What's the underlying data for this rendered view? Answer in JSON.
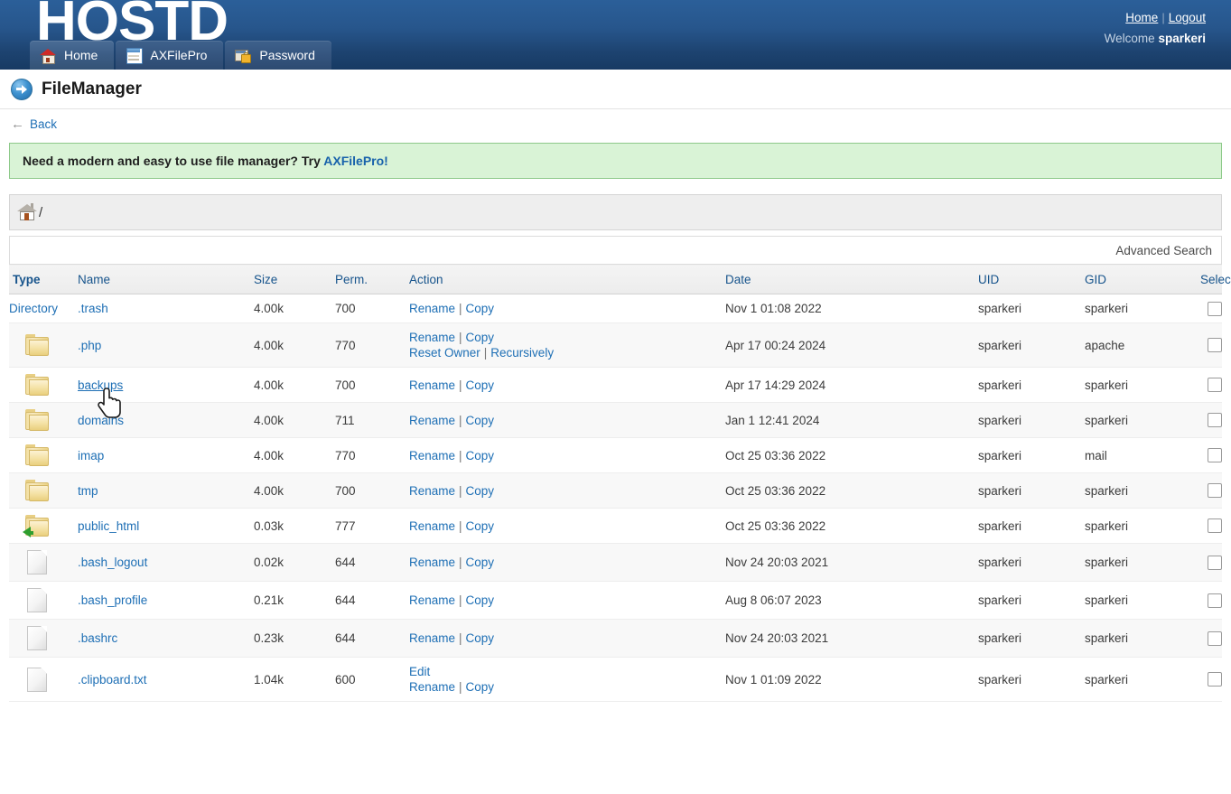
{
  "header": {
    "brand": "HOSTD",
    "links": {
      "home": "Home",
      "separator": "|",
      "logout": "Logout"
    },
    "welcome_prefix": "Welcome",
    "welcome_user": "sparkeri",
    "tabs": [
      {
        "label": "Home",
        "icon": "home-icon",
        "active": true
      },
      {
        "label": "AXFilePro",
        "icon": "axfilepro-icon",
        "active": false
      },
      {
        "label": "Password",
        "icon": "password-icon",
        "active": false
      }
    ]
  },
  "page": {
    "title": "FileManager",
    "title_icon": "arrow-right-circle-icon",
    "back_label": "Back",
    "back_icon": "arrow-left-icon"
  },
  "notice": {
    "text": "Need a modern and easy to use file manager? Try ",
    "link": "AXFilePro!"
  },
  "breadcrumb": {
    "home_icon": "home-icon",
    "path": "/"
  },
  "search": {
    "advanced_label": "Advanced Search"
  },
  "table": {
    "columns": [
      "Type",
      "Name",
      "Size",
      "Perm.",
      "Action",
      "Date",
      "UID",
      "GID",
      "Select"
    ],
    "actions": {
      "rename": "Rename",
      "copy": "Copy",
      "reset_owner": "Reset Owner",
      "recursively": "Recursively",
      "edit": "Edit",
      "pipe": "|"
    },
    "rows": [
      {
        "type": "Directory",
        "type_kind": "text",
        "name": ".trash",
        "size": "4.00k",
        "perm": "700",
        "actions": [
          "Rename | Copy"
        ],
        "date": "Nov 1 01:08 2022",
        "uid": "sparkeri",
        "gid": "sparkeri",
        "hovered": false
      },
      {
        "type": "",
        "type_kind": "folder",
        "name": ".php",
        "size": "4.00k",
        "perm": "770",
        "actions": [
          "Rename | Copy",
          "Reset Owner | Recursively"
        ],
        "date": "Apr 17 00:24 2024",
        "uid": "sparkeri",
        "gid": "apache",
        "hovered": false
      },
      {
        "type": "",
        "type_kind": "folder",
        "name": "backups",
        "size": "4.00k",
        "perm": "700",
        "actions": [
          "Rename | Copy"
        ],
        "date": "Apr 17 14:29 2024",
        "uid": "sparkeri",
        "gid": "sparkeri",
        "hovered": true
      },
      {
        "type": "",
        "type_kind": "folder",
        "name": "domains",
        "size": "4.00k",
        "perm": "711",
        "actions": [
          "Rename | Copy"
        ],
        "date": "Jan 1 12:41 2024",
        "uid": "sparkeri",
        "gid": "sparkeri",
        "hovered": false
      },
      {
        "type": "",
        "type_kind": "folder",
        "name": "imap",
        "size": "4.00k",
        "perm": "770",
        "actions": [
          "Rename | Copy"
        ],
        "date": "Oct 25 03:36 2022",
        "uid": "sparkeri",
        "gid": "mail",
        "hovered": false
      },
      {
        "type": "",
        "type_kind": "folder",
        "name": "tmp",
        "size": "4.00k",
        "perm": "700",
        "actions": [
          "Rename | Copy"
        ],
        "date": "Oct 25 03:36 2022",
        "uid": "sparkeri",
        "gid": "sparkeri",
        "hovered": false
      },
      {
        "type": "",
        "type_kind": "folder-link",
        "name": "public_html",
        "size": "0.03k",
        "perm": "777",
        "actions": [
          "Rename | Copy"
        ],
        "date": "Oct 25 03:36 2022",
        "uid": "sparkeri",
        "gid": "sparkeri",
        "hovered": false
      },
      {
        "type": "",
        "type_kind": "file",
        "name": ".bash_logout",
        "size": "0.02k",
        "perm": "644",
        "actions": [
          "Rename | Copy"
        ],
        "date": "Nov 24 20:03 2021",
        "uid": "sparkeri",
        "gid": "sparkeri",
        "hovered": false
      },
      {
        "type": "",
        "type_kind": "file",
        "name": ".bash_profile",
        "size": "0.21k",
        "perm": "644",
        "actions": [
          "Rename | Copy"
        ],
        "date": "Aug 8 06:07 2023",
        "uid": "sparkeri",
        "gid": "sparkeri",
        "hovered": false
      },
      {
        "type": "",
        "type_kind": "file",
        "name": ".bashrc",
        "size": "0.23k",
        "perm": "644",
        "actions": [
          "Rename | Copy"
        ],
        "date": "Nov 24 20:03 2021",
        "uid": "sparkeri",
        "gid": "sparkeri",
        "hovered": false
      },
      {
        "type": "",
        "type_kind": "file",
        "name": ".clipboard.txt",
        "size": "1.04k",
        "perm": "600",
        "actions": [
          "Edit",
          "Rename | Copy"
        ],
        "date": "Nov 1 01:09 2022",
        "uid": "sparkeri",
        "gid": "sparkeri",
        "hovered": false
      }
    ]
  },
  "colors": {
    "header_blue": "#27568c",
    "link_blue": "#1e6fb5",
    "header_text_blue": "#17548c",
    "notice_green_bg": "#d9f3d6",
    "notice_green_border": "#8ec98a"
  }
}
